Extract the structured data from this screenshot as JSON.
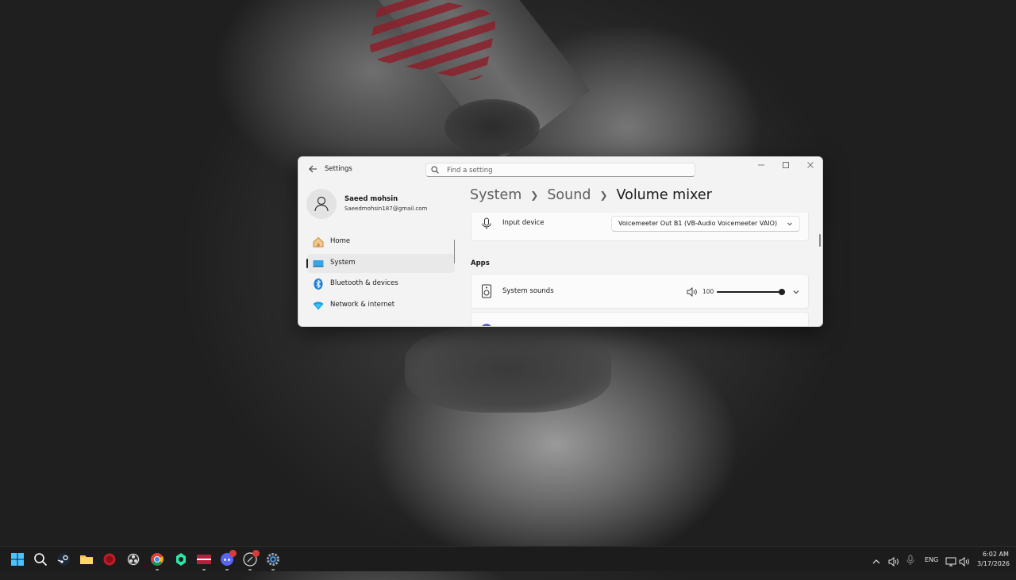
{
  "window": {
    "app_title": "Settings",
    "search_placeholder": "Find a setting",
    "controls": [
      "minimize",
      "maximize",
      "close"
    ]
  },
  "profile": {
    "name": "Saeed mohsin",
    "email": "Saeedmohsin187@gmail.com"
  },
  "sidebar": {
    "items": [
      {
        "label": "Home",
        "icon": "home-icon",
        "active": false
      },
      {
        "label": "System",
        "icon": "system-icon",
        "active": true
      },
      {
        "label": "Bluetooth & devices",
        "icon": "bluetooth-icon",
        "active": false
      },
      {
        "label": "Network & internet",
        "icon": "wifi-icon",
        "active": false
      }
    ]
  },
  "breadcrumb": {
    "items": [
      "System",
      "Sound"
    ],
    "current": "Volume mixer"
  },
  "input_device": {
    "label": "Input device",
    "value": "Voicemeeter Out B1 (VB-Audio Voicemeeter VAIO)"
  },
  "apps": {
    "section_title": "Apps",
    "items": [
      {
        "name": "System sounds",
        "volume": 100,
        "level": 1.0
      }
    ]
  },
  "taskbar": {
    "apps": [
      "start",
      "search",
      "steam",
      "file-explorer",
      "red-app",
      "obs",
      "chrome",
      "game-app",
      "voicemeeter",
      "discord",
      "media-app",
      "settings"
    ],
    "tray": {
      "language": "ENG",
      "time": "6:02 AM",
      "date": "3/17/2026"
    }
  },
  "colors": {
    "accent": "#1f1f1f",
    "window_bg": "#f3f3f3",
    "card_bg": "#fbfbfb",
    "taskbar_bg": "#1c1c1c"
  }
}
